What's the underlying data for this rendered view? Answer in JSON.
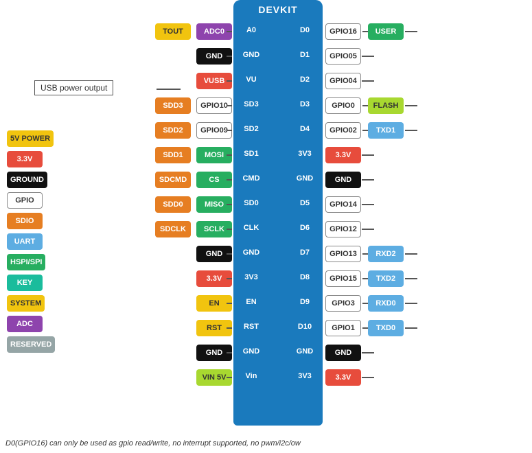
{
  "title": "DEVKIT",
  "note": "D0(GPIO16) can only be used as gpio read/write, no interrupt supported, no pwm/i2c/ow",
  "usb_label": "USB power output",
  "board": {
    "left_pins": [
      {
        "label": "A0",
        "sub": "TOUT",
        "chip1": "TOUT",
        "chip1_color": "yellow",
        "chip2": "ADC0",
        "chip2_color": "purple"
      },
      {
        "label": "GND",
        "sub": "",
        "chip1": "",
        "chip1_color": "",
        "chip2": "GND",
        "chip2_color": "black"
      },
      {
        "label": "VU",
        "sub": "VUSB",
        "chip1": "",
        "chip1_color": "",
        "chip2": "VUSB",
        "chip2_color": "red"
      },
      {
        "label": "SD3",
        "sub": "SDD3",
        "chip1": "SDD3",
        "chip1_color": "orange",
        "chip2": "GPIO10",
        "chip2_color": "outline"
      },
      {
        "label": "SD2",
        "sub": "SDD2",
        "chip1": "SDD2",
        "chip1_color": "orange",
        "chip2": "GPIO09",
        "chip2_color": "outline"
      },
      {
        "label": "SD1",
        "sub": "SDD1",
        "chip1": "SDD1",
        "chip1_color": "orange",
        "chip2": "MOSI",
        "chip2_color": "green"
      },
      {
        "label": "CMD",
        "sub": "SDCMD",
        "chip1": "SDCMD",
        "chip1_color": "orange",
        "chip2": "CS",
        "chip2_color": "green"
      },
      {
        "label": "SD0",
        "sub": "SDD0",
        "chip1": "SDD0",
        "chip1_color": "orange",
        "chip2": "MISO",
        "chip2_color": "green"
      },
      {
        "label": "CLK",
        "sub": "SDCLK",
        "chip1": "SDCLK",
        "chip1_color": "orange",
        "chip2": "SCLK",
        "chip2_color": "green"
      },
      {
        "label": "GND",
        "sub": "",
        "chip1": "",
        "chip1_color": "",
        "chip2": "GND",
        "chip2_color": "black"
      },
      {
        "label": "3V3",
        "sub": "",
        "chip1": "",
        "chip1_color": "",
        "chip2": "3.3V",
        "chip2_color": "red"
      },
      {
        "label": "EN",
        "sub": "",
        "chip1": "",
        "chip1_color": "",
        "chip2": "EN",
        "chip2_color": "yellow"
      },
      {
        "label": "RST",
        "sub": "",
        "chip1": "",
        "chip1_color": "",
        "chip2": "RST",
        "chip2_color": "yellow"
      },
      {
        "label": "GND",
        "sub": "",
        "chip1": "",
        "chip1_color": "",
        "chip2": "GND",
        "chip2_color": "black"
      },
      {
        "label": "Vin",
        "sub": "",
        "chip1": "",
        "chip1_color": "",
        "chip2": "VIN 5V",
        "chip2_color": "lime"
      }
    ],
    "right_pins": [
      {
        "label": "D0",
        "chip1": "GPIO16",
        "chip1_color": "outline",
        "chip2": "USER",
        "chip2_color": "green"
      },
      {
        "label": "D1",
        "chip1": "GPIO05",
        "chip1_color": "outline",
        "chip2": "",
        "chip2_color": ""
      },
      {
        "label": "D2",
        "chip1": "GPIO04",
        "chip1_color": "outline",
        "chip2": "",
        "chip2_color": ""
      },
      {
        "label": "D3",
        "chip1": "GPIO0",
        "chip1_color": "outline",
        "chip2": "FLASH",
        "chip2_color": "lime"
      },
      {
        "label": "D4",
        "chip1": "GPIO02",
        "chip1_color": "outline",
        "chip2": "TXD1",
        "chip2_color": "blue-light"
      },
      {
        "label": "3V3",
        "chip1": "3.3V",
        "chip1_color": "red",
        "chip2": "",
        "chip2_color": ""
      },
      {
        "label": "GND",
        "chip1": "GND",
        "chip1_color": "black",
        "chip2": "",
        "chip2_color": ""
      },
      {
        "label": "D5",
        "chip1": "GPIO14",
        "chip1_color": "outline",
        "chip2": "",
        "chip2_color": ""
      },
      {
        "label": "D6",
        "chip1": "GPIO12",
        "chip1_color": "outline",
        "chip2": "",
        "chip2_color": ""
      },
      {
        "label": "D7",
        "chip1": "GPIO13",
        "chip1_color": "outline",
        "chip2": "RXD2",
        "chip2_color": "blue-light"
      },
      {
        "label": "D8",
        "chip1": "GPIO15",
        "chip1_color": "outline",
        "chip2": "TXD2",
        "chip2_color": "blue-light"
      },
      {
        "label": "D9",
        "chip1": "GPIO3",
        "chip1_color": "outline",
        "chip2": "RXD0",
        "chip2_color": "blue-light"
      },
      {
        "label": "D10",
        "chip1": "GPIO1",
        "chip1_color": "outline",
        "chip2": "TXD0",
        "chip2_color": "blue-light"
      },
      {
        "label": "GND",
        "chip1": "GND",
        "chip1_color": "black",
        "chip2": "",
        "chip2_color": ""
      },
      {
        "label": "3V3",
        "chip1": "3.3V",
        "chip1_color": "red",
        "chip2": "",
        "chip2_color": ""
      }
    ]
  },
  "legend": [
    {
      "label": "5V POWER",
      "color": "yellow"
    },
    {
      "label": "3.3V",
      "color": "red"
    },
    {
      "label": "GROUND",
      "color": "black"
    },
    {
      "label": "GPIO",
      "color": "outline"
    },
    {
      "label": "SDIO",
      "color": "orange"
    },
    {
      "label": "UART",
      "color": "blue-light"
    },
    {
      "label": "HSPI/SPI",
      "color": "green"
    },
    {
      "label": "KEY",
      "color": "teal"
    },
    {
      "label": "SYSTEM",
      "color": "yellow"
    },
    {
      "label": "ADC",
      "color": "purple"
    },
    {
      "label": "RESERVED",
      "color": "gray"
    }
  ]
}
